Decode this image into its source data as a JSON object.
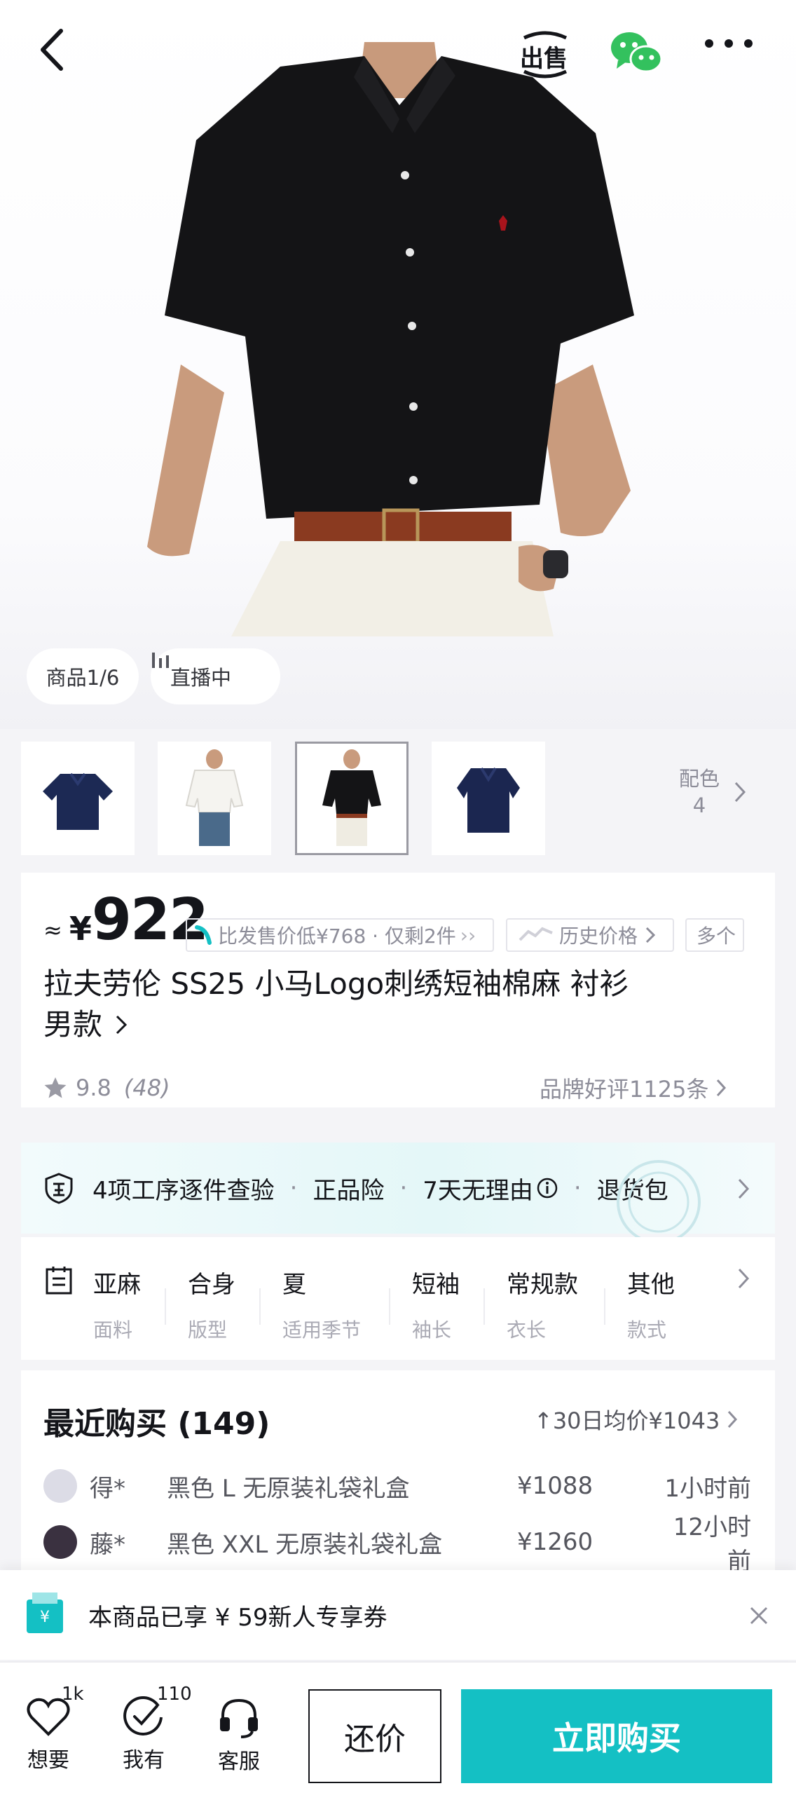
{
  "header": {
    "back_icon": "chevron-left-icon",
    "sell_label": "出售",
    "wechat_icon": "wechat-icon",
    "more_icon": "more-dots-icon"
  },
  "hero": {
    "product_counter": "商品1/6",
    "live_label": "直播中"
  },
  "variants": {
    "thumbnails": [
      "navy-shirt",
      "white-shirt-model",
      "black-shirt-model",
      "navy-shirt-2"
    ],
    "selected_index": 2,
    "color_label": "配色",
    "color_count": "4"
  },
  "price_card": {
    "approx": "≈",
    "currency": "¥",
    "price": "922",
    "promo_tag": "比发售价低¥768 · 仅剩2件",
    "history_tag": "历史价格",
    "more_tag": "多个",
    "title": "拉夫劳伦 SS25 小马Logo刺绣短袖棉麻 衬衫",
    "title_line2": "男款",
    "rating": "9.8",
    "rating_count": "(48)",
    "brand_reviews": "品牌好评1125条"
  },
  "guarantee": {
    "items": [
      "4项工序逐件查验",
      "正品险",
      "7天无理由",
      "退货包"
    ]
  },
  "attributes": [
    {
      "value": "亚麻",
      "key": "面料"
    },
    {
      "value": "合身",
      "key": "版型"
    },
    {
      "value": "夏",
      "key": "适用季节"
    },
    {
      "value": "短袖",
      "key": "袖长"
    },
    {
      "value": "常规款",
      "key": "衣长"
    },
    {
      "value": "其他",
      "key": "款式"
    }
  ],
  "recent": {
    "title": "最近购买 (149)",
    "avg_price": "↑30日均价¥1043",
    "rows": [
      {
        "user": "得*",
        "spec": "黑色 L 无原装礼袋礼盒",
        "price": "¥1088",
        "time": "1小时前"
      },
      {
        "user": "藤*",
        "spec": "黑色 XXL 无原装礼袋礼盒",
        "price": "¥1260",
        "time": "12小时前"
      }
    ]
  },
  "coupon": {
    "text": "本商品已享 ¥ 59新人专享券"
  },
  "bottom_bar": {
    "want_label": "想要",
    "want_count": "1k",
    "have_label": "我有",
    "have_count": "110",
    "service_label": "客服",
    "bargain_label": "还价",
    "buy_label": "立即购买"
  },
  "colors": {
    "accent": "#14c0c4",
    "text": "#14151a",
    "muted": "#8d8d99"
  }
}
